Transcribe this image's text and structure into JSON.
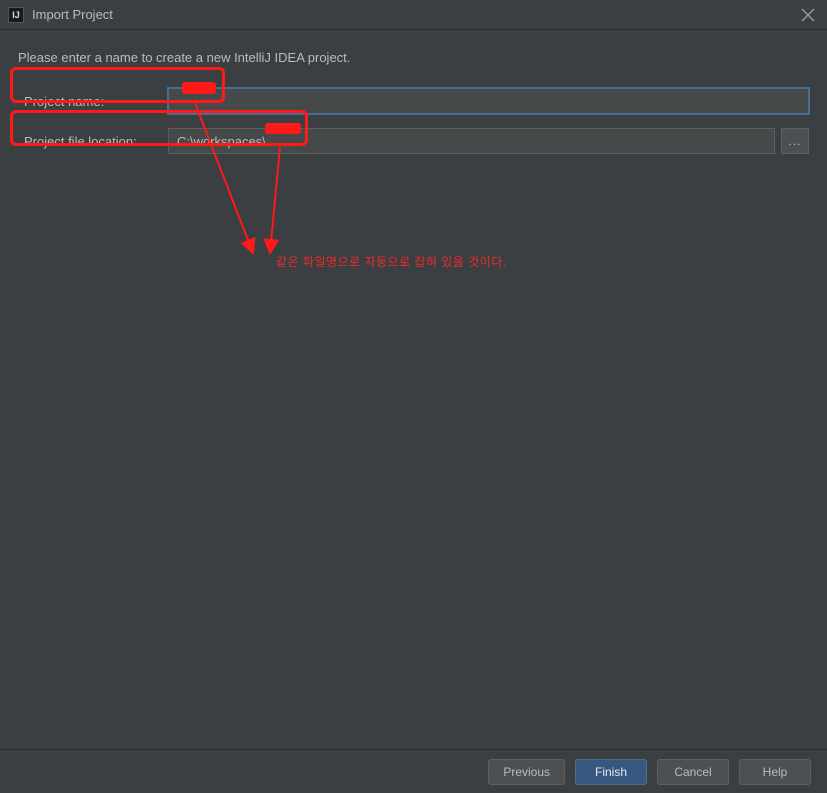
{
  "titlebar": {
    "title": "Import Project"
  },
  "instruction": "Please enter a name to create a new IntelliJ IDEA project.",
  "form": {
    "projectName": {
      "label": "Project name:",
      "value": ""
    },
    "projectLocation": {
      "label": "Project file location:",
      "value": "C:\\workspaces\\",
      "browseLabel": "..."
    }
  },
  "annotation": {
    "text": "같은 파일명으로 자동으로 잡혀 있을 것이다."
  },
  "buttons": {
    "previous": "Previous",
    "finish": "Finish",
    "cancel": "Cancel",
    "help": "Help"
  }
}
